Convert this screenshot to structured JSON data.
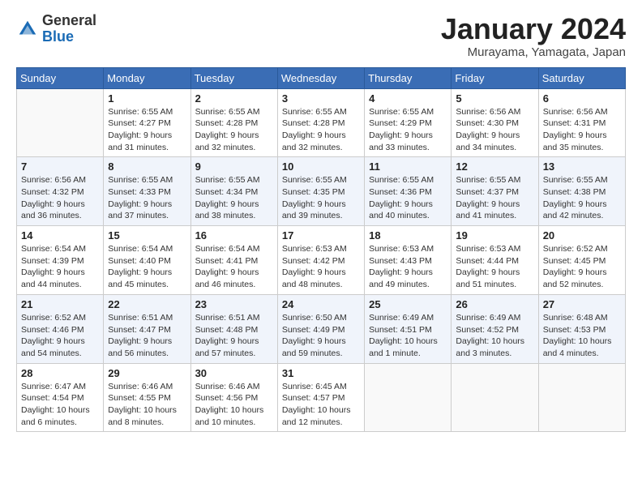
{
  "header": {
    "logo_general": "General",
    "logo_blue": "Blue",
    "month_year": "January 2024",
    "location": "Murayama, Yamagata, Japan"
  },
  "days_of_week": [
    "Sunday",
    "Monday",
    "Tuesday",
    "Wednesday",
    "Thursday",
    "Friday",
    "Saturday"
  ],
  "weeks": [
    [
      {
        "day": "",
        "sunrise": "",
        "sunset": "",
        "daylight": ""
      },
      {
        "day": "1",
        "sunrise": "Sunrise: 6:55 AM",
        "sunset": "Sunset: 4:27 PM",
        "daylight": "Daylight: 9 hours and 31 minutes."
      },
      {
        "day": "2",
        "sunrise": "Sunrise: 6:55 AM",
        "sunset": "Sunset: 4:28 PM",
        "daylight": "Daylight: 9 hours and 32 minutes."
      },
      {
        "day": "3",
        "sunrise": "Sunrise: 6:55 AM",
        "sunset": "Sunset: 4:28 PM",
        "daylight": "Daylight: 9 hours and 32 minutes."
      },
      {
        "day": "4",
        "sunrise": "Sunrise: 6:55 AM",
        "sunset": "Sunset: 4:29 PM",
        "daylight": "Daylight: 9 hours and 33 minutes."
      },
      {
        "day": "5",
        "sunrise": "Sunrise: 6:56 AM",
        "sunset": "Sunset: 4:30 PM",
        "daylight": "Daylight: 9 hours and 34 minutes."
      },
      {
        "day": "6",
        "sunrise": "Sunrise: 6:56 AM",
        "sunset": "Sunset: 4:31 PM",
        "daylight": "Daylight: 9 hours and 35 minutes."
      }
    ],
    [
      {
        "day": "7",
        "sunrise": "Sunrise: 6:56 AM",
        "sunset": "Sunset: 4:32 PM",
        "daylight": "Daylight: 9 hours and 36 minutes."
      },
      {
        "day": "8",
        "sunrise": "Sunrise: 6:55 AM",
        "sunset": "Sunset: 4:33 PM",
        "daylight": "Daylight: 9 hours and 37 minutes."
      },
      {
        "day": "9",
        "sunrise": "Sunrise: 6:55 AM",
        "sunset": "Sunset: 4:34 PM",
        "daylight": "Daylight: 9 hours and 38 minutes."
      },
      {
        "day": "10",
        "sunrise": "Sunrise: 6:55 AM",
        "sunset": "Sunset: 4:35 PM",
        "daylight": "Daylight: 9 hours and 39 minutes."
      },
      {
        "day": "11",
        "sunrise": "Sunrise: 6:55 AM",
        "sunset": "Sunset: 4:36 PM",
        "daylight": "Daylight: 9 hours and 40 minutes."
      },
      {
        "day": "12",
        "sunrise": "Sunrise: 6:55 AM",
        "sunset": "Sunset: 4:37 PM",
        "daylight": "Daylight: 9 hours and 41 minutes."
      },
      {
        "day": "13",
        "sunrise": "Sunrise: 6:55 AM",
        "sunset": "Sunset: 4:38 PM",
        "daylight": "Daylight: 9 hours and 42 minutes."
      }
    ],
    [
      {
        "day": "14",
        "sunrise": "Sunrise: 6:54 AM",
        "sunset": "Sunset: 4:39 PM",
        "daylight": "Daylight: 9 hours and 44 minutes."
      },
      {
        "day": "15",
        "sunrise": "Sunrise: 6:54 AM",
        "sunset": "Sunset: 4:40 PM",
        "daylight": "Daylight: 9 hours and 45 minutes."
      },
      {
        "day": "16",
        "sunrise": "Sunrise: 6:54 AM",
        "sunset": "Sunset: 4:41 PM",
        "daylight": "Daylight: 9 hours and 46 minutes."
      },
      {
        "day": "17",
        "sunrise": "Sunrise: 6:53 AM",
        "sunset": "Sunset: 4:42 PM",
        "daylight": "Daylight: 9 hours and 48 minutes."
      },
      {
        "day": "18",
        "sunrise": "Sunrise: 6:53 AM",
        "sunset": "Sunset: 4:43 PM",
        "daylight": "Daylight: 9 hours and 49 minutes."
      },
      {
        "day": "19",
        "sunrise": "Sunrise: 6:53 AM",
        "sunset": "Sunset: 4:44 PM",
        "daylight": "Daylight: 9 hours and 51 minutes."
      },
      {
        "day": "20",
        "sunrise": "Sunrise: 6:52 AM",
        "sunset": "Sunset: 4:45 PM",
        "daylight": "Daylight: 9 hours and 52 minutes."
      }
    ],
    [
      {
        "day": "21",
        "sunrise": "Sunrise: 6:52 AM",
        "sunset": "Sunset: 4:46 PM",
        "daylight": "Daylight: 9 hours and 54 minutes."
      },
      {
        "day": "22",
        "sunrise": "Sunrise: 6:51 AM",
        "sunset": "Sunset: 4:47 PM",
        "daylight": "Daylight: 9 hours and 56 minutes."
      },
      {
        "day": "23",
        "sunrise": "Sunrise: 6:51 AM",
        "sunset": "Sunset: 4:48 PM",
        "daylight": "Daylight: 9 hours and 57 minutes."
      },
      {
        "day": "24",
        "sunrise": "Sunrise: 6:50 AM",
        "sunset": "Sunset: 4:49 PM",
        "daylight": "Daylight: 9 hours and 59 minutes."
      },
      {
        "day": "25",
        "sunrise": "Sunrise: 6:49 AM",
        "sunset": "Sunset: 4:51 PM",
        "daylight": "Daylight: 10 hours and 1 minute."
      },
      {
        "day": "26",
        "sunrise": "Sunrise: 6:49 AM",
        "sunset": "Sunset: 4:52 PM",
        "daylight": "Daylight: 10 hours and 3 minutes."
      },
      {
        "day": "27",
        "sunrise": "Sunrise: 6:48 AM",
        "sunset": "Sunset: 4:53 PM",
        "daylight": "Daylight: 10 hours and 4 minutes."
      }
    ],
    [
      {
        "day": "28",
        "sunrise": "Sunrise: 6:47 AM",
        "sunset": "Sunset: 4:54 PM",
        "daylight": "Daylight: 10 hours and 6 minutes."
      },
      {
        "day": "29",
        "sunrise": "Sunrise: 6:46 AM",
        "sunset": "Sunset: 4:55 PM",
        "daylight": "Daylight: 10 hours and 8 minutes."
      },
      {
        "day": "30",
        "sunrise": "Sunrise: 6:46 AM",
        "sunset": "Sunset: 4:56 PM",
        "daylight": "Daylight: 10 hours and 10 minutes."
      },
      {
        "day": "31",
        "sunrise": "Sunrise: 6:45 AM",
        "sunset": "Sunset: 4:57 PM",
        "daylight": "Daylight: 10 hours and 12 minutes."
      },
      {
        "day": "",
        "sunrise": "",
        "sunset": "",
        "daylight": ""
      },
      {
        "day": "",
        "sunrise": "",
        "sunset": "",
        "daylight": ""
      },
      {
        "day": "",
        "sunrise": "",
        "sunset": "",
        "daylight": ""
      }
    ]
  ]
}
